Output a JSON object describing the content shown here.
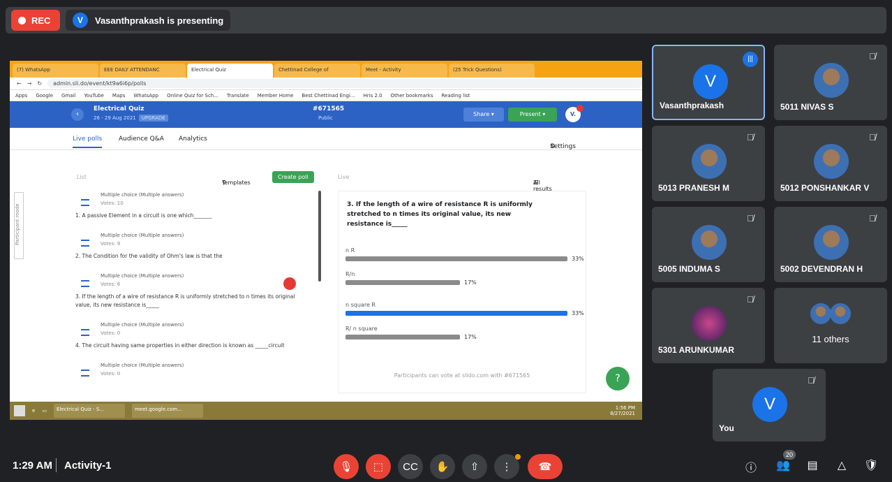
{
  "topbar": {
    "rec_label": "REC",
    "presenter_initial": "V",
    "presenter_text": "Vasanthprakash is presenting"
  },
  "browser": {
    "tabs": [
      "(7) WhatsApp",
      "EEE DAILY ATTENDANC",
      "Electrical Quiz",
      "Chettinad College of",
      "Meet - Activity",
      "(25 Trick Questions)"
    ],
    "url": "admin.sli.do/event/kt9a6i6p/polls",
    "bookmarks": [
      "Apps",
      "Google",
      "Gmail",
      "YouTube",
      "Maps",
      "WhatsApp",
      "Online Quiz for Sch...",
      "Translate",
      "Member Home",
      "Best Chettinad Engi...",
      "Hris 2.0",
      "Other bookmarks",
      "Reading list"
    ]
  },
  "slido": {
    "event_name": "Electrical Quiz",
    "event_date": "26 - 29 Aug 2021",
    "upgrade": "UPGRADE",
    "code": "#671565",
    "visibility": "Public",
    "share": "Share ▾",
    "present": "Present ▾",
    "user": "V.",
    "tabs": {
      "live": "Live polls",
      "qa": "Audience Q&A",
      "analytics": "Analytics",
      "settings": "Settings"
    },
    "list_label": "List",
    "templates": "Templates",
    "create": "Create poll",
    "live_label": "Live",
    "all_results": "All results",
    "participant_mode": "Participant mode",
    "polls": [
      {
        "type": "Multiple choice (Multiple answers)",
        "votes": "Votes: 10",
        "question": "1. A passive Element in a circuit is one which_______"
      },
      {
        "type": "Multiple choice (Multiple answers)",
        "votes": "Votes: 9",
        "question": "2. The Condition for the validity of Ohm's law is that the"
      },
      {
        "type": "Multiple choice (Multiple answers)",
        "votes": "Votes: 6",
        "question": "3. If the length of a wire of resistance R is uniformly stretched to n times its original value, its new resistance is_____"
      },
      {
        "type": "Multiple choice (Multiple answers)",
        "votes": "Votes: 0",
        "question": "4. The circuit having same properties in either direction is known as _____circuit"
      },
      {
        "type": "Multiple choice (Multiple answers)",
        "votes": "Votes: 0",
        "question": ""
      }
    ],
    "live_question": "3. If the length of a wire of resistance R is uniformly stretched to n times its original value, its new resistance is_____",
    "options": [
      {
        "label": "n R",
        "percent": "33%",
        "value": 0.33,
        "color": "#8b8b8b"
      },
      {
        "label": "R/n",
        "percent": "17%",
        "value": 0.17,
        "color": "#8b8b8b"
      },
      {
        "label": "n square R",
        "percent": "33%",
        "value": 0.33,
        "color": "#1a73e8"
      },
      {
        "label": "R/ n square",
        "percent": "17%",
        "value": 0.17,
        "color": "#8b8b8b"
      }
    ],
    "participants_note": "Participants can vote at slido.com with #671565"
  },
  "taskbar": {
    "app1": "Electrical Quiz - S...",
    "app2": "meet.google.com...",
    "time": "1:56 PM",
    "date": "8/27/2021"
  },
  "participants": [
    {
      "name": "Vasanthprakash",
      "initial": "V"
    },
    {
      "name": "5011 NIVAS S"
    },
    {
      "name": "5013 PRANESH M"
    },
    {
      "name": "5012 PONSHANKAR V"
    },
    {
      "name": "5005 INDUMA S"
    },
    {
      "name": "5002 DEVENDRAN H"
    },
    {
      "name": "5301 ARUNKUMAR"
    },
    {
      "others": "11 others"
    },
    {
      "name": "You",
      "initial": "V"
    }
  ],
  "bottom": {
    "time": "1:29 AM",
    "meeting": "Activity-1",
    "people_count": "20"
  }
}
